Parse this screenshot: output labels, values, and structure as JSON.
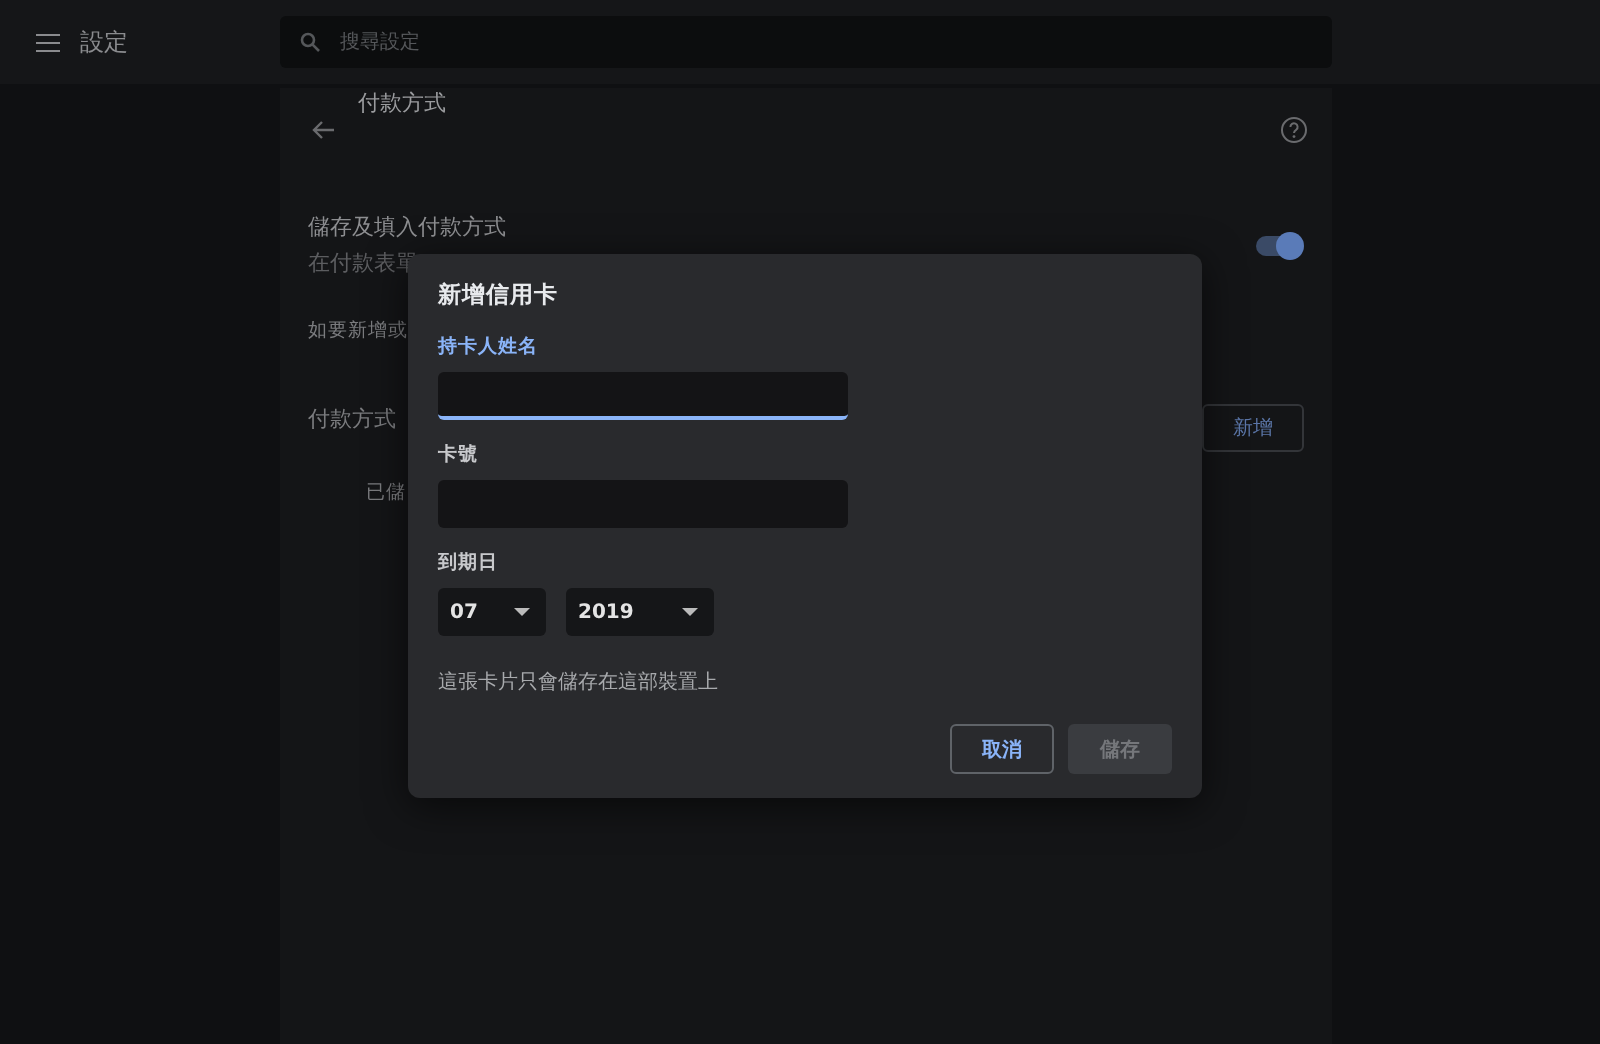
{
  "toolbar": {
    "title": "設定",
    "search": {
      "placeholder": "搜尋設定"
    }
  },
  "page": {
    "title": "付款方式",
    "setting": {
      "label": "儲存及填入付款方式",
      "description": "在付款表單",
      "on": true
    },
    "hint": "如要新增或",
    "section": {
      "label": "付款方式",
      "button": "新增"
    },
    "saved": "已儲"
  },
  "dialog": {
    "title": "新增信用卡",
    "fields": [
      {
        "label": "持卡人姓名",
        "focused": true
      },
      {
        "label": "卡號",
        "focused": false
      }
    ],
    "expiry": {
      "label": "到期日",
      "month": "07",
      "year": "2019"
    },
    "note": "這張卡片只會儲存在這部裝置上",
    "buttons": [
      {
        "label": "取消",
        "kind": "secondary",
        "disabled": false
      },
      {
        "label": "儲存",
        "kind": "primary",
        "disabled": true
      }
    ]
  }
}
